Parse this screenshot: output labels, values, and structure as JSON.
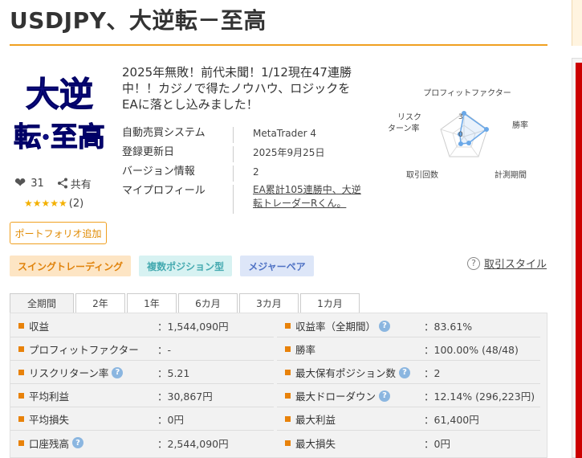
{
  "title": "USDJPY、大逆転－至高",
  "logo": {
    "line1": "大逆",
    "line2": "転·至高"
  },
  "likes": {
    "count": "31",
    "share_label": "共有"
  },
  "rating": {
    "stars": "★★★★★",
    "count": "(2)",
    "value": 5
  },
  "portfolio_button": "ポートフォリオ追加",
  "headline": "2025年無敗！前代未聞！1/12現在47連勝中！！カジノで得たノウハウ、ロジックを EAに落とし込みました！",
  "info": [
    {
      "label": "自動売買システム",
      "value": "MetaTrader 4"
    },
    {
      "label": "登録更新日",
      "value": "2025年9月25日"
    },
    {
      "label": "バージョン情報",
      "value": "2"
    },
    {
      "label": "マイプロフィール",
      "value": "EA累計105連勝中、大逆転トレーダーRくん。"
    }
  ],
  "radar": {
    "labels": [
      "プロフィットファクター",
      "勝率",
      "計測期間",
      "取引回数",
      "リスクリターン率"
    ],
    "tick_high": "3",
    "tick_low": "0",
    "accent": "#6aa8e8"
  },
  "tags": [
    "スイングトレーディング",
    "複数ポジション型",
    "メジャーペア"
  ],
  "style_link": "取引スタイル",
  "tabs": [
    "全期間",
    "2年",
    "1年",
    "6カ月",
    "3カ月",
    "1カ月"
  ],
  "stats_left": [
    {
      "label": "収益",
      "value": "：1,544,090円",
      "help": false
    },
    {
      "label": "プロフィットファクター",
      "value": "：-",
      "help": false
    },
    {
      "label": "リスクリターン率",
      "value": "：5.21",
      "help": true
    },
    {
      "label": "平均利益",
      "value": "：30,867円",
      "help": false
    },
    {
      "label": "平均損失",
      "value": "：0円",
      "help": false
    },
    {
      "label": "口座残高",
      "value": "：2,544,090円",
      "help": true
    }
  ],
  "stats_right": [
    {
      "label": "収益率（全期間）",
      "value": "：83.61%",
      "help": true
    },
    {
      "label": "勝率",
      "value": "：100.00% (48/48)",
      "help": false
    },
    {
      "label": "最大保有ポジション数",
      "value": "：2",
      "help": true
    },
    {
      "label": "最大ドローダウン",
      "value": "：12.14% (296,223円)",
      "help": true
    },
    {
      "label": "最大利益",
      "value": "：61,400円",
      "help": false
    },
    {
      "label": "最大損失",
      "value": "：0円",
      "help": false
    }
  ],
  "colors": {
    "accent": "#f0a020",
    "logo_blue": "#10108a"
  }
}
